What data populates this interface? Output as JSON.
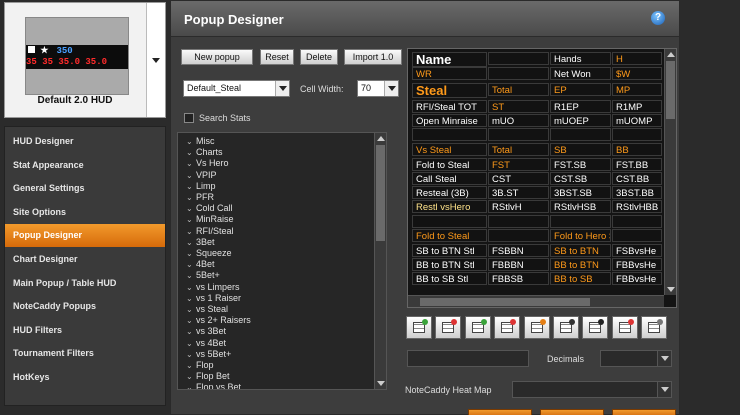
{
  "hud": {
    "preview_line1_blue": "350",
    "preview_line2": "35  35  35.0  35.0",
    "name": "Default 2.0 HUD"
  },
  "nav": {
    "items": [
      {
        "label": "HUD Designer",
        "active": false
      },
      {
        "label": "Stat Appearance",
        "active": false
      },
      {
        "label": "General Settings",
        "active": false
      },
      {
        "label": "Site Options",
        "active": false
      },
      {
        "label": "Popup Designer",
        "active": true
      },
      {
        "label": "Chart Designer",
        "active": false
      },
      {
        "label": "Main Popup / Table HUD",
        "active": false
      },
      {
        "label": "NoteCaddy Popups",
        "active": false
      },
      {
        "label": "HUD Filters",
        "active": false
      },
      {
        "label": "Tournament Filters",
        "active": false
      },
      {
        "label": "HotKeys",
        "active": false
      }
    ]
  },
  "main": {
    "title": "Popup Designer",
    "help_icon": "?",
    "toolbar": {
      "new_popup": "New popup",
      "reset": "Reset",
      "delete": "Delete",
      "import": "Import 1.0"
    },
    "popup_select": "Default_Steal",
    "cell_width_label": "Cell Width:",
    "cell_width_value": "70",
    "search_stats_label": "Search Stats",
    "decimals_label": "Decimals",
    "heatmap_label": "NoteCaddy Heat Map"
  },
  "stats_tree": [
    "Misc",
    "Charts",
    "Vs Hero",
    "VPIP",
    "Limp",
    "PFR",
    "Cold Call",
    "MinRaise",
    "RFI/Steal",
    "3Bet",
    "Squeeze",
    "4Bet",
    "5Bet+",
    "vs Limpers",
    "vs 1 Raiser",
    "vs Steal",
    "vs 2+ Raisers",
    "vs 3Bet",
    "vs 4Bet",
    "vs 5Bet+",
    "Flop",
    "Flop Bet",
    "Flop vs Bet"
  ],
  "colors": {
    "white": "#ffffff",
    "orange": "#ff9a1a",
    "yellow": "#ffe38a",
    "accent": "#e57f14"
  },
  "popup_grid": {
    "rows": [
      [
        {
          "text": "Name",
          "color": "#ffffff",
          "big": true
        },
        {
          "text": "",
          "color": "#ffffff"
        },
        {
          "text": "Hands",
          "color": "#ffffff"
        },
        {
          "text": "H",
          "color": "#ff9a1a"
        }
      ],
      [
        {
          "text": "WR",
          "color": "#ff9a1a"
        },
        {
          "text": "",
          "color": "#ffffff"
        },
        {
          "text": "Net Won",
          "color": "#ffffff"
        },
        {
          "text": "$W",
          "color": "#ff9a1a"
        }
      ],
      [
        {
          "text": "Steal",
          "color": "#ff9a1a",
          "big": true
        },
        {
          "text": "Total",
          "color": "#ff9a1a"
        },
        {
          "text": "EP",
          "color": "#ff9a1a"
        },
        {
          "text": "MP",
          "color": "#ff9a1a"
        }
      ],
      [
        {
          "text": "RFI/Steal TOT",
          "color": "#ffffff"
        },
        {
          "text": "ST",
          "color": "#ff9a1a"
        },
        {
          "text": "R1EP",
          "color": "#ffffff"
        },
        {
          "text": "R1MP",
          "color": "#ffffff"
        }
      ],
      [
        {
          "text": "Open Minraise",
          "color": "#ffffff"
        },
        {
          "text": "mUO",
          "color": "#ffffff"
        },
        {
          "text": "mUOEP",
          "color": "#ffffff"
        },
        {
          "text": "mUOMP",
          "color": "#ffffff"
        }
      ],
      [
        {
          "text": "",
          "color": "#ffffff"
        },
        {
          "text": "",
          "color": "#ffffff"
        },
        {
          "text": "",
          "color": "#ffffff"
        },
        {
          "text": "",
          "color": "#ffffff"
        }
      ],
      [
        {
          "text": "Vs Steal",
          "color": "#ff9a1a"
        },
        {
          "text": "Total",
          "color": "#ff9a1a"
        },
        {
          "text": "SB",
          "color": "#ff9a1a"
        },
        {
          "text": "BB",
          "color": "#ff9a1a"
        }
      ],
      [
        {
          "text": "Fold to Steal",
          "color": "#ffffff"
        },
        {
          "text": "FST",
          "color": "#ff9a1a"
        },
        {
          "text": "FST.SB",
          "color": "#ffffff"
        },
        {
          "text": "FST.BB",
          "color": "#ffffff"
        }
      ],
      [
        {
          "text": "Call Steal",
          "color": "#ffffff"
        },
        {
          "text": "CST",
          "color": "#ffffff"
        },
        {
          "text": "CST.SB",
          "color": "#ffffff"
        },
        {
          "text": "CST.BB",
          "color": "#ffffff"
        }
      ],
      [
        {
          "text": "Resteal (3B)",
          "color": "#ffffff"
        },
        {
          "text": "3B.ST",
          "color": "#ffffff"
        },
        {
          "text": "3BST.SB",
          "color": "#ffffff"
        },
        {
          "text": "3BST.BB",
          "color": "#ffffff"
        }
      ],
      [
        {
          "text": "Restl vsHero",
          "color": "#ffe38a"
        },
        {
          "text": "RStlvH",
          "color": "#ffffff"
        },
        {
          "text": "RStlvHSB",
          "color": "#ffffff"
        },
        {
          "text": "RStlvHBB",
          "color": "#ffffff"
        }
      ],
      [
        {
          "text": "",
          "color": "#ffffff"
        },
        {
          "text": "",
          "color": "#ffffff"
        },
        {
          "text": "",
          "color": "#ffffff"
        },
        {
          "text": "",
          "color": "#ffffff"
        }
      ],
      [
        {
          "text": "Fold to Steal",
          "color": "#ff9a1a"
        },
        {
          "text": "",
          "color": "#ffffff"
        },
        {
          "text": "Fold to Hero Steal",
          "color": "#ff9a1a"
        },
        {
          "text": "",
          "color": "#ffffff"
        }
      ],
      [
        {
          "text": "SB to BTN Stl",
          "color": "#ffffff"
        },
        {
          "text": "FSBBN",
          "color": "#ffffff"
        },
        {
          "text": "SB to BTN",
          "color": "#ff9a1a"
        },
        {
          "text": "FSBvsHe",
          "color": "#ffffff"
        }
      ],
      [
        {
          "text": "BB to BTN Stl",
          "color": "#ffffff"
        },
        {
          "text": "FBBBN",
          "color": "#ffffff"
        },
        {
          "text": "BB to BTN",
          "color": "#ff9a1a"
        },
        {
          "text": "FBBvsHe",
          "color": "#ffffff"
        }
      ],
      [
        {
          "text": "BB to SB Stl",
          "color": "#ffffff"
        },
        {
          "text": "FBBSB",
          "color": "#ffffff"
        },
        {
          "text": "BB to SB",
          "color": "#ff9a1a"
        },
        {
          "text": "FBBvsHe",
          "color": "#ffffff"
        }
      ]
    ]
  },
  "tool_icons": [
    "grid-add-icon",
    "grid-delete-icon",
    "grid-add-row-icon",
    "grid-delete-row-icon",
    "eraser-icon",
    "font-icon",
    "border-icon",
    "text-color-icon",
    "cell-settings-icon"
  ]
}
